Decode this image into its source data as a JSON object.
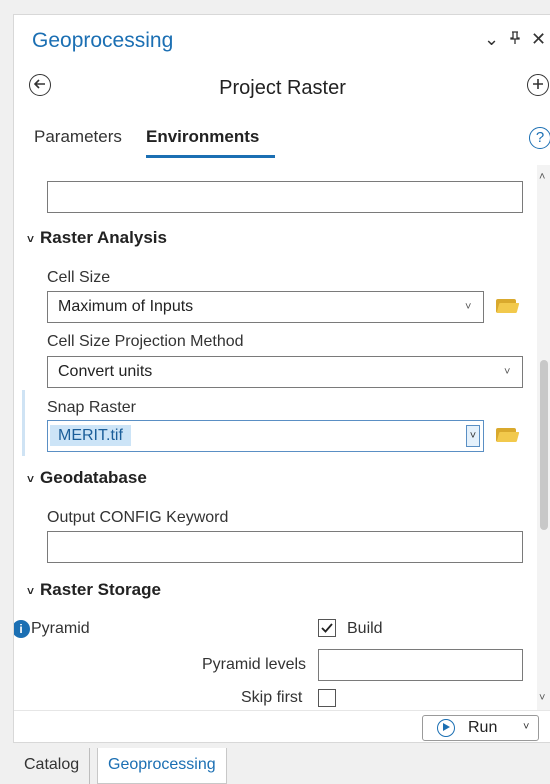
{
  "window": {
    "title": "Geoprocessing",
    "controls": {
      "dropdown": "⌄",
      "pin": "⊥",
      "close": "✕"
    }
  },
  "tool": {
    "title": "Project Raster",
    "back_icon": "back-arrow-icon",
    "add_icon": "plus-circle-icon"
  },
  "tabs": [
    {
      "label": "Parameters",
      "active": false
    },
    {
      "label": "Environments",
      "active": true
    }
  ],
  "help_label": "?",
  "sections": {
    "raster_analysis": {
      "title": "Raster Analysis",
      "cell_size": {
        "label": "Cell Size",
        "value": "Maximum of Inputs"
      },
      "cell_size_projection": {
        "label": "Cell Size Projection Method",
        "value": "Convert units"
      },
      "snap_raster": {
        "label": "Snap Raster",
        "value": "MERIT.tif"
      }
    },
    "geodatabase": {
      "title": "Geodatabase",
      "output_config": {
        "label": "Output CONFIG Keyword",
        "value": ""
      }
    },
    "raster_storage": {
      "title": "Raster Storage",
      "pyramid": {
        "label": "Pyramid",
        "build_label": "Build",
        "build_checked": true,
        "levels_label": "Pyramid levels",
        "levels_value": "",
        "skip_first_label": "Skip first",
        "skip_first_checked": false
      }
    }
  },
  "run_button": {
    "label": "Run"
  },
  "bottom_tabs": [
    {
      "label": "Catalog",
      "active": false
    },
    {
      "label": "Geoprocessing",
      "active": true
    }
  ],
  "colors": {
    "accent": "#1b6fb3",
    "selection": "#cce4f7",
    "folder": "#f2c94c"
  }
}
